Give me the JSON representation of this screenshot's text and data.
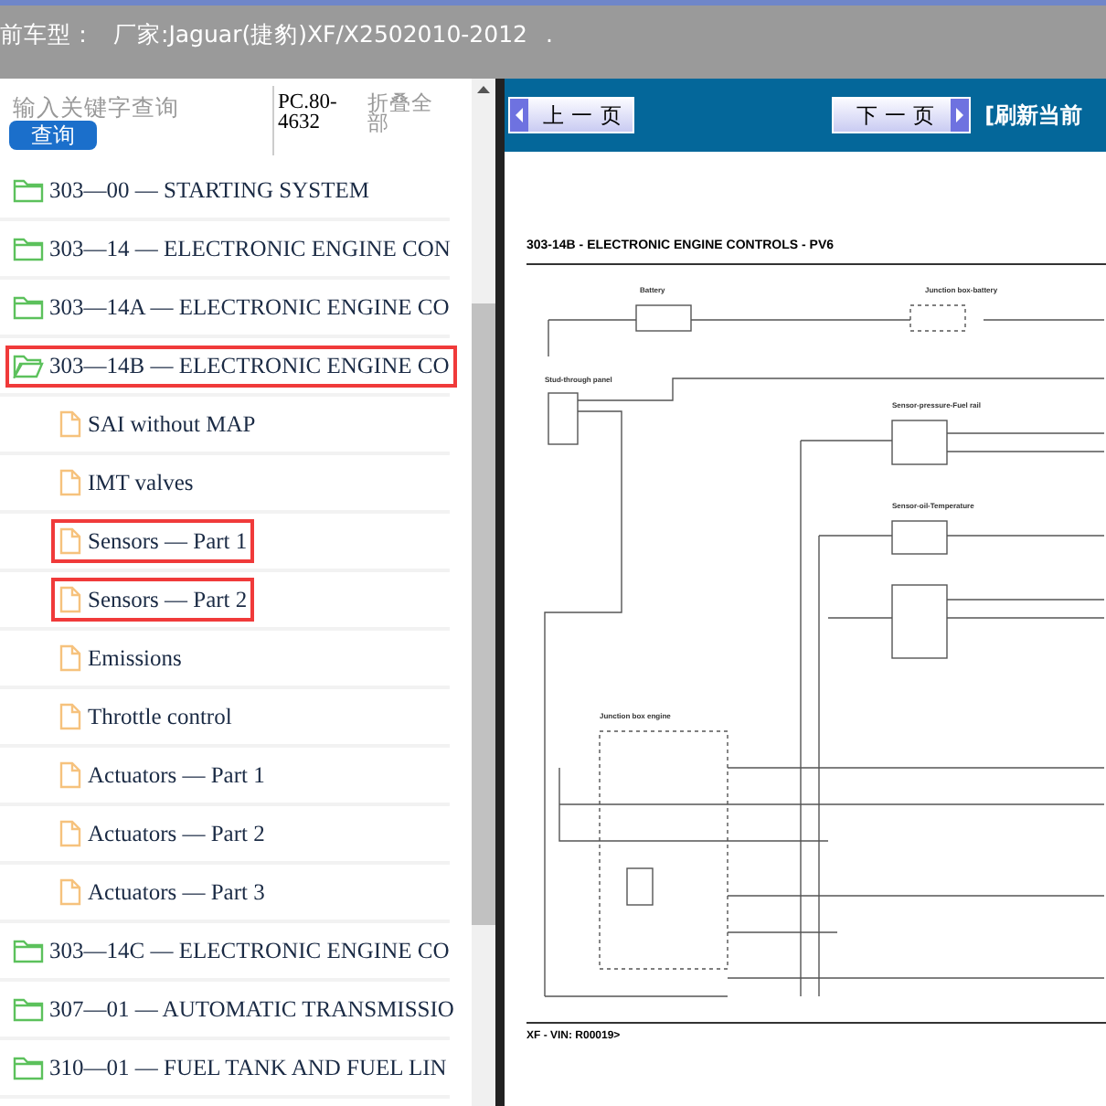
{
  "header": {
    "label": "前车型：",
    "model": "厂家:Jaguar(捷豹)XF/X2502010-2012",
    "mark": "."
  },
  "search": {
    "placeholder": "输入关键字查询",
    "button": "查询",
    "code": "PC.80-4632",
    "collapse": "折叠全部"
  },
  "tree": [
    {
      "label": "303—00 — STARTING SYSTEM",
      "kind": "folder",
      "expanded": false,
      "highlighted": false
    },
    {
      "label": "303—14 — ELECTRONIC ENGINE CON",
      "kind": "folder",
      "expanded": false,
      "highlighted": false
    },
    {
      "label": "303—14A — ELECTRONIC ENGINE CO",
      "kind": "folder",
      "expanded": false,
      "highlighted": false
    },
    {
      "label": "303—14B — ELECTRONIC ENGINE CO",
      "kind": "folder",
      "expanded": true,
      "highlighted": true,
      "children": [
        {
          "label": "SAI without MAP",
          "kind": "page",
          "highlighted": false
        },
        {
          "label": "IMT valves",
          "kind": "page",
          "highlighted": false
        },
        {
          "label": "Sensors — Part 1",
          "kind": "page",
          "highlighted": true
        },
        {
          "label": "Sensors — Part 2",
          "kind": "page",
          "highlighted": true
        },
        {
          "label": "Emissions",
          "kind": "page",
          "highlighted": false
        },
        {
          "label": "Throttle control",
          "kind": "page",
          "highlighted": false
        },
        {
          "label": "Actuators — Part 1",
          "kind": "page",
          "highlighted": false
        },
        {
          "label": "Actuators — Part 2",
          "kind": "page",
          "highlighted": false
        },
        {
          "label": "Actuators — Part 3",
          "kind": "page",
          "highlighted": false
        }
      ]
    },
    {
      "label": "303—14C — ELECTRONIC ENGINE CO",
      "kind": "folder",
      "expanded": false,
      "highlighted": false
    },
    {
      "label": "307—01 — AUTOMATIC TRANSMISSIO",
      "kind": "folder",
      "expanded": false,
      "highlighted": false
    },
    {
      "label": "310—01 — FUEL TANK AND FUEL LIN",
      "kind": "folder",
      "expanded": false,
      "highlighted": false
    }
  ],
  "toolbar": {
    "prev": "上 一 页",
    "next": "下 一 页",
    "refresh": "[刷新当前"
  },
  "document": {
    "title": "303-14B - ELECTRONIC ENGINE CONTROLS - PV6",
    "labels": [
      "Battery",
      "Junction box-battery",
      "Stud-through panel",
      "Sensor-pressure-Fuel rail",
      "Sensor-oil-Temperature",
      "Junction box engine"
    ],
    "footer": "XF - VIN: R00019>"
  }
}
